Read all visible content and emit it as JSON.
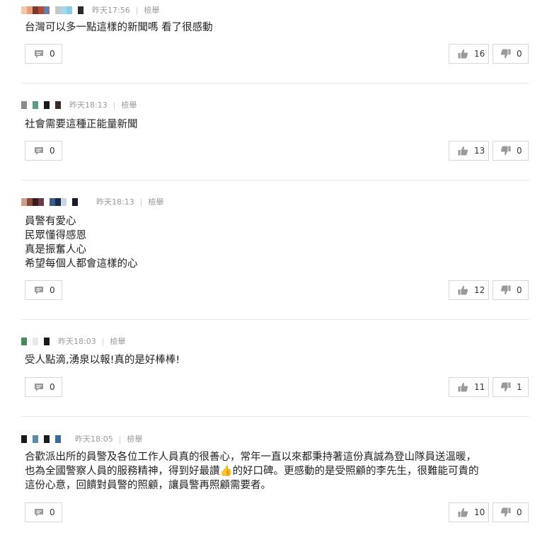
{
  "comments": [
    {
      "time": "昨天17:56",
      "report_label": "檢舉",
      "name_pixels": [
        "#f2c9a8",
        "#e8a07a",
        "#7a3a2a",
        "#b24a3a",
        "#6a7ea8",
        "#ffffff",
        "#c7c7c7",
        "#a8d8e8",
        "#8acde8",
        "#ffffff",
        "#2a2a2a"
      ],
      "lines": [
        "台灣可以多一點這樣的新聞嗎 看了很感動"
      ],
      "reply_count": "0",
      "like_count": "16",
      "dislike_count": "0"
    },
    {
      "time": "昨天18:13",
      "report_label": "檢舉",
      "name_pixels": [
        "#8a8a8a",
        "#ffffff",
        "#5a9a8a",
        "#ffffff",
        "#1a1a1a",
        "#ffffff",
        "#3a2a2a"
      ],
      "lines": [
        "社會需要這種正能量新聞"
      ],
      "reply_count": "0",
      "like_count": "13",
      "dislike_count": "0"
    },
    {
      "time": "昨天18:13",
      "report_label": "檢舉",
      "name_pixels": [
        "#c9a08a",
        "#8a4a3a",
        "#3a1a1a",
        "#6a3a4a",
        "#ffffff",
        "#3a5a8a",
        "#1a2a4a",
        "#c7d7e7",
        "#ffffff",
        "#1a1a2a"
      ],
      "lines": [
        "員警有愛心",
        "民眾懂得感恩",
        "真是振奮人心",
        "希望每個人都會這樣的心"
      ],
      "reply_count": "0",
      "like_count": "12",
      "dislike_count": "0"
    },
    {
      "time": "昨天18:03",
      "report_label": "檢舉",
      "name_pixels": [
        "#4a8a5a",
        "#ffffff",
        "#e8e8e8",
        "#ffffff",
        "#1a1a1a"
      ],
      "lines": [
        "受人點滴,湧泉以報!真的是好棒棒!"
      ],
      "reply_count": "0",
      "like_count": "11",
      "dislike_count": "1"
    },
    {
      "time": "昨天18:05",
      "report_label": "檢舉",
      "name_pixels": [
        "#1a1a1a",
        "#ffffff",
        "#5a8aa8",
        "#ffffff",
        "#1a1a1a",
        "#ffffff",
        "#3a6a9a",
        "#ffffff"
      ],
      "lines": [
        "合歡派出所的員警及各位工作人員真的很善心，常年一直以來都秉持著這份真誠為登山隊員送溫暖，",
        "也為全國警察人員的服務精神，得到好最讚",
        "這份心意，回饋對員警的照顧，讓員警再照顧需要者。"
      ],
      "line2_emoji": "👍",
      "line2_rest": "的好口碑。更感動的是受照顧的李先生，很難能可貴的",
      "reply_count": "0",
      "like_count": "10",
      "dislike_count": "0"
    }
  ],
  "icons": {
    "reply": "comment-bubble-icon",
    "like": "thumbs-up-icon",
    "dislike": "thumbs-down-icon"
  },
  "colors": {
    "icon_gray": "#9a9a9a",
    "meta_gray": "#9a9a9a",
    "border": "#d8d8d8"
  }
}
